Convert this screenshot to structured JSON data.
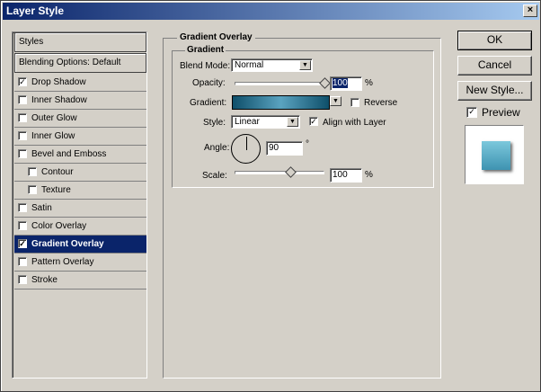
{
  "window": {
    "title": "Layer Style",
    "close_glyph": "×"
  },
  "sidebar": {
    "items": [
      {
        "label": "Styles",
        "checked": null,
        "indent": 0,
        "selected": false
      },
      {
        "label": "Blending Options: Default",
        "checked": null,
        "indent": 0,
        "selected": false
      },
      {
        "label": "Drop Shadow",
        "checked": true,
        "indent": 0,
        "selected": false
      },
      {
        "label": "Inner Shadow",
        "checked": false,
        "indent": 0,
        "selected": false
      },
      {
        "label": "Outer Glow",
        "checked": false,
        "indent": 0,
        "selected": false
      },
      {
        "label": "Inner Glow",
        "checked": false,
        "indent": 0,
        "selected": false
      },
      {
        "label": "Bevel and Emboss",
        "checked": false,
        "indent": 0,
        "selected": false
      },
      {
        "label": "Contour",
        "checked": false,
        "indent": 1,
        "selected": false
      },
      {
        "label": "Texture",
        "checked": false,
        "indent": 1,
        "selected": false
      },
      {
        "label": "Satin",
        "checked": false,
        "indent": 0,
        "selected": false
      },
      {
        "label": "Color Overlay",
        "checked": false,
        "indent": 0,
        "selected": false
      },
      {
        "label": "Gradient Overlay",
        "checked": true,
        "indent": 0,
        "selected": true
      },
      {
        "label": "Pattern Overlay",
        "checked": false,
        "indent": 0,
        "selected": false
      },
      {
        "label": "Stroke",
        "checked": false,
        "indent": 0,
        "selected": false
      }
    ]
  },
  "panel": {
    "title": "Gradient Overlay",
    "group_title": "Gradient",
    "blend_mode_label": "Blend Mode:",
    "blend_mode_value": "Normal",
    "opacity_label": "Opacity:",
    "opacity_value": "100",
    "opacity_unit": "%",
    "gradient_label": "Gradient:",
    "reverse_label": "Reverse",
    "reverse_checked": false,
    "style_label": "Style:",
    "style_value": "Linear",
    "align_label": "Align with Layer",
    "align_checked": true,
    "angle_label": "Angle:",
    "angle_value": "90",
    "angle_unit": "°",
    "scale_label": "Scale:",
    "scale_value": "100",
    "scale_unit": "%"
  },
  "buttons": {
    "ok": "OK",
    "cancel": "Cancel",
    "new_style": "New Style..."
  },
  "preview": {
    "label": "Preview",
    "checked": true
  },
  "colors": {
    "accent": "#0a246a",
    "gradient_dark": "#0e4f6a",
    "gradient_light": "#5aa3c0",
    "dialog_bg": "#d4d0c8"
  }
}
